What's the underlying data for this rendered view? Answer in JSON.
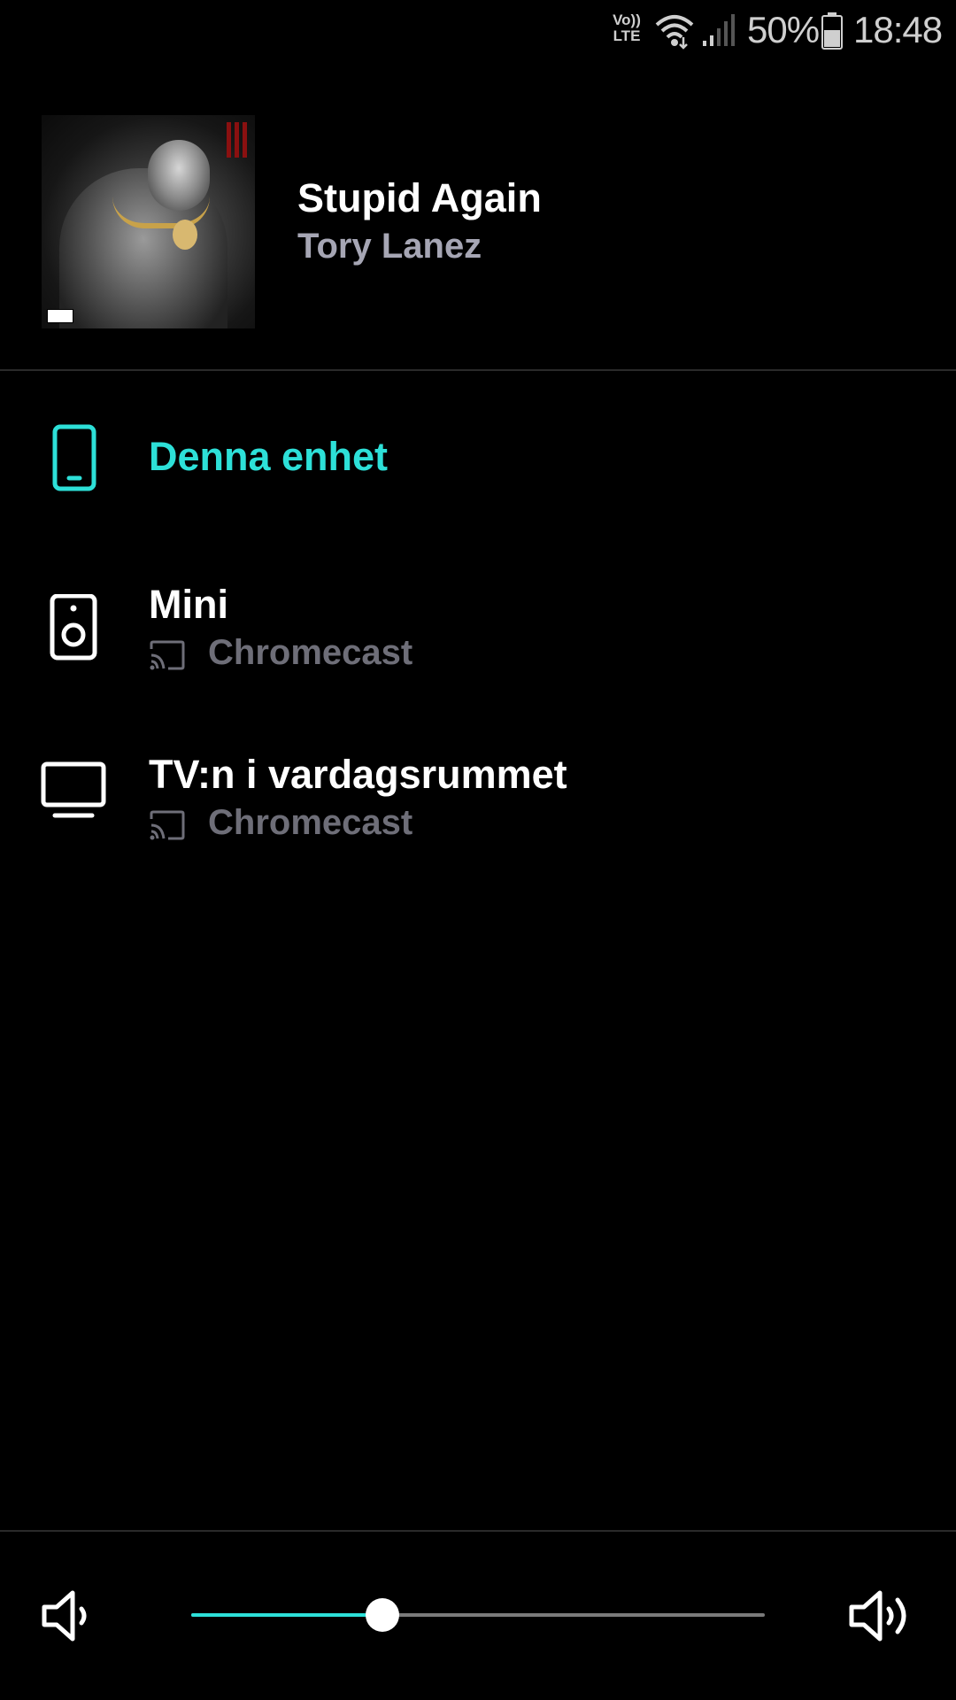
{
  "status_bar": {
    "volte": "Vo))\nLTE",
    "battery_percent": "50%",
    "time": "18:48"
  },
  "now_playing": {
    "title": "Stupid Again",
    "artist": "Tory Lanez"
  },
  "devices": [
    {
      "name": "Denna enhet",
      "type": "phone",
      "icon": "phone-icon",
      "active": true
    },
    {
      "name": "Mini",
      "type": "speaker",
      "icon": "speaker-icon",
      "subtitle": "Chromecast",
      "subtitle_icon": "cast-icon",
      "active": false
    },
    {
      "name": "TV:n i vardagsrummet",
      "type": "tv",
      "icon": "tv-icon",
      "subtitle": "Chromecast",
      "subtitle_icon": "cast-icon",
      "active": false
    }
  ],
  "volume": {
    "level": 0.333,
    "min_icon": "volume-low-icon",
    "max_icon": "volume-high-icon"
  },
  "colors": {
    "accent": "#2de0d8",
    "background": "#000000",
    "primary_text": "#ffffff",
    "secondary_text": "#a6a6b4",
    "muted_text": "#6e6e78"
  }
}
